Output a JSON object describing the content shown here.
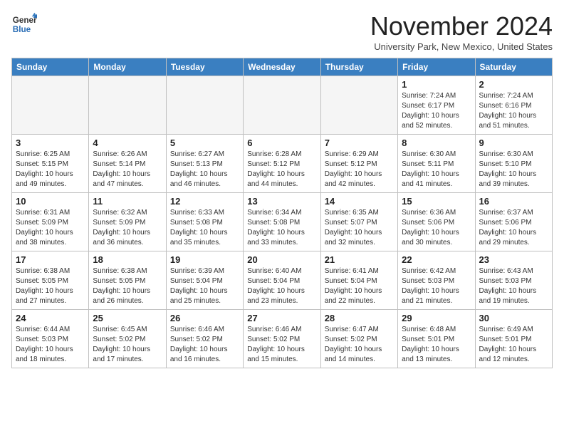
{
  "header": {
    "logo": {
      "general": "General",
      "blue": "Blue"
    },
    "title": "November 2024",
    "subtitle": "University Park, New Mexico, United States"
  },
  "calendar": {
    "weekdays": [
      "Sunday",
      "Monday",
      "Tuesday",
      "Wednesday",
      "Thursday",
      "Friday",
      "Saturday"
    ],
    "weeks": [
      [
        {
          "day": "",
          "empty": true
        },
        {
          "day": "",
          "empty": true
        },
        {
          "day": "",
          "empty": true
        },
        {
          "day": "",
          "empty": true
        },
        {
          "day": "",
          "empty": true
        },
        {
          "day": "1",
          "sunrise": "Sunrise: 7:24 AM",
          "sunset": "Sunset: 6:17 PM",
          "daylight": "Daylight: 10 hours and 52 minutes."
        },
        {
          "day": "2",
          "sunrise": "Sunrise: 7:24 AM",
          "sunset": "Sunset: 6:16 PM",
          "daylight": "Daylight: 10 hours and 51 minutes."
        }
      ],
      [
        {
          "day": "3",
          "sunrise": "Sunrise: 6:25 AM",
          "sunset": "Sunset: 5:15 PM",
          "daylight": "Daylight: 10 hours and 49 minutes."
        },
        {
          "day": "4",
          "sunrise": "Sunrise: 6:26 AM",
          "sunset": "Sunset: 5:14 PM",
          "daylight": "Daylight: 10 hours and 47 minutes."
        },
        {
          "day": "5",
          "sunrise": "Sunrise: 6:27 AM",
          "sunset": "Sunset: 5:13 PM",
          "daylight": "Daylight: 10 hours and 46 minutes."
        },
        {
          "day": "6",
          "sunrise": "Sunrise: 6:28 AM",
          "sunset": "Sunset: 5:12 PM",
          "daylight": "Daylight: 10 hours and 44 minutes."
        },
        {
          "day": "7",
          "sunrise": "Sunrise: 6:29 AM",
          "sunset": "Sunset: 5:12 PM",
          "daylight": "Daylight: 10 hours and 42 minutes."
        },
        {
          "day": "8",
          "sunrise": "Sunrise: 6:30 AM",
          "sunset": "Sunset: 5:11 PM",
          "daylight": "Daylight: 10 hours and 41 minutes."
        },
        {
          "day": "9",
          "sunrise": "Sunrise: 6:30 AM",
          "sunset": "Sunset: 5:10 PM",
          "daylight": "Daylight: 10 hours and 39 minutes."
        }
      ],
      [
        {
          "day": "10",
          "sunrise": "Sunrise: 6:31 AM",
          "sunset": "Sunset: 5:09 PM",
          "daylight": "Daylight: 10 hours and 38 minutes."
        },
        {
          "day": "11",
          "sunrise": "Sunrise: 6:32 AM",
          "sunset": "Sunset: 5:09 PM",
          "daylight": "Daylight: 10 hours and 36 minutes."
        },
        {
          "day": "12",
          "sunrise": "Sunrise: 6:33 AM",
          "sunset": "Sunset: 5:08 PM",
          "daylight": "Daylight: 10 hours and 35 minutes."
        },
        {
          "day": "13",
          "sunrise": "Sunrise: 6:34 AM",
          "sunset": "Sunset: 5:08 PM",
          "daylight": "Daylight: 10 hours and 33 minutes."
        },
        {
          "day": "14",
          "sunrise": "Sunrise: 6:35 AM",
          "sunset": "Sunset: 5:07 PM",
          "daylight": "Daylight: 10 hours and 32 minutes."
        },
        {
          "day": "15",
          "sunrise": "Sunrise: 6:36 AM",
          "sunset": "Sunset: 5:06 PM",
          "daylight": "Daylight: 10 hours and 30 minutes."
        },
        {
          "day": "16",
          "sunrise": "Sunrise: 6:37 AM",
          "sunset": "Sunset: 5:06 PM",
          "daylight": "Daylight: 10 hours and 29 minutes."
        }
      ],
      [
        {
          "day": "17",
          "sunrise": "Sunrise: 6:38 AM",
          "sunset": "Sunset: 5:05 PM",
          "daylight": "Daylight: 10 hours and 27 minutes."
        },
        {
          "day": "18",
          "sunrise": "Sunrise: 6:38 AM",
          "sunset": "Sunset: 5:05 PM",
          "daylight": "Daylight: 10 hours and 26 minutes."
        },
        {
          "day": "19",
          "sunrise": "Sunrise: 6:39 AM",
          "sunset": "Sunset: 5:04 PM",
          "daylight": "Daylight: 10 hours and 25 minutes."
        },
        {
          "day": "20",
          "sunrise": "Sunrise: 6:40 AM",
          "sunset": "Sunset: 5:04 PM",
          "daylight": "Daylight: 10 hours and 23 minutes."
        },
        {
          "day": "21",
          "sunrise": "Sunrise: 6:41 AM",
          "sunset": "Sunset: 5:04 PM",
          "daylight": "Daylight: 10 hours and 22 minutes."
        },
        {
          "day": "22",
          "sunrise": "Sunrise: 6:42 AM",
          "sunset": "Sunset: 5:03 PM",
          "daylight": "Daylight: 10 hours and 21 minutes."
        },
        {
          "day": "23",
          "sunrise": "Sunrise: 6:43 AM",
          "sunset": "Sunset: 5:03 PM",
          "daylight": "Daylight: 10 hours and 19 minutes."
        }
      ],
      [
        {
          "day": "24",
          "sunrise": "Sunrise: 6:44 AM",
          "sunset": "Sunset: 5:03 PM",
          "daylight": "Daylight: 10 hours and 18 minutes."
        },
        {
          "day": "25",
          "sunrise": "Sunrise: 6:45 AM",
          "sunset": "Sunset: 5:02 PM",
          "daylight": "Daylight: 10 hours and 17 minutes."
        },
        {
          "day": "26",
          "sunrise": "Sunrise: 6:46 AM",
          "sunset": "Sunset: 5:02 PM",
          "daylight": "Daylight: 10 hours and 16 minutes."
        },
        {
          "day": "27",
          "sunrise": "Sunrise: 6:46 AM",
          "sunset": "Sunset: 5:02 PM",
          "daylight": "Daylight: 10 hours and 15 minutes."
        },
        {
          "day": "28",
          "sunrise": "Sunrise: 6:47 AM",
          "sunset": "Sunset: 5:02 PM",
          "daylight": "Daylight: 10 hours and 14 minutes."
        },
        {
          "day": "29",
          "sunrise": "Sunrise: 6:48 AM",
          "sunset": "Sunset: 5:01 PM",
          "daylight": "Daylight: 10 hours and 13 minutes."
        },
        {
          "day": "30",
          "sunrise": "Sunrise: 6:49 AM",
          "sunset": "Sunset: 5:01 PM",
          "daylight": "Daylight: 10 hours and 12 minutes."
        }
      ]
    ]
  }
}
